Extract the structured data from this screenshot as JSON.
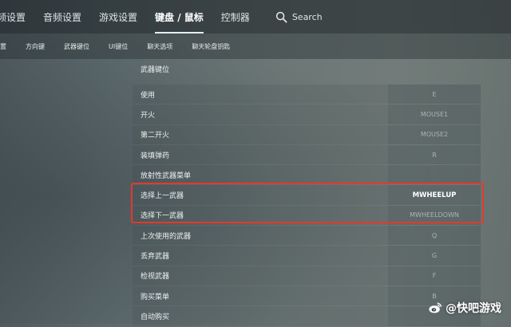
{
  "top_tabs": [
    {
      "label": "音频设置"
    },
    {
      "label": "音频设置"
    },
    {
      "label": "游戏设置"
    },
    {
      "label": "键盘 / 鼠标",
      "active": true
    },
    {
      "label": "控制器"
    }
  ],
  "search": {
    "label": "Search"
  },
  "sub_tabs": [
    {
      "label": "设置"
    },
    {
      "label": "方向键"
    },
    {
      "label": "武器键位"
    },
    {
      "label": "UI键位"
    },
    {
      "label": "聊天选项"
    },
    {
      "label": "聊天轮盘钥匙"
    }
  ],
  "section": {
    "title": "武器键位"
  },
  "bindings": [
    {
      "action": "使用",
      "key": "E"
    },
    {
      "action": "开火",
      "key": "MOUSE1"
    },
    {
      "action": "第二开火",
      "key": "MOUSE2"
    },
    {
      "action": "装填弹药",
      "key": "R"
    },
    {
      "action": "放射性武器菜单",
      "key": ""
    },
    {
      "action": "选择上一武器",
      "key": "MWHEELUP"
    },
    {
      "action": "选择下一武器",
      "key": "MWHEELDOWN"
    },
    {
      "action": "上次使用的武器",
      "key": "Q"
    },
    {
      "action": "丢弃武器",
      "key": "G"
    },
    {
      "action": "检视武器",
      "key": "F"
    },
    {
      "action": "购买菜单",
      "key": "B"
    },
    {
      "action": "自动购买",
      "key": ""
    }
  ],
  "colors": {
    "highlight": "#e33a2e",
    "background": "#6b7676"
  },
  "watermark": {
    "text": "@快吧游戏",
    "icon": "weibo-logo-icon"
  }
}
